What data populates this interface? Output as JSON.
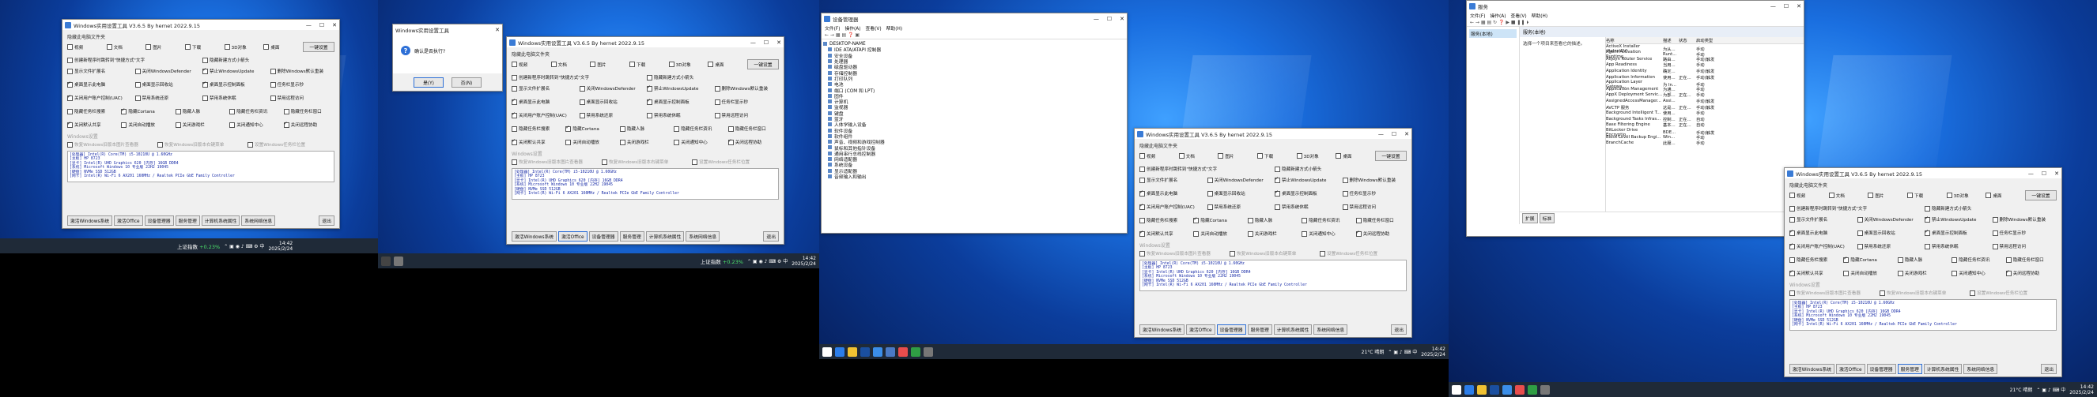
{
  "app": {
    "title": "Windows实用设置工具 V3.6.5 By hernet 2022.9.15",
    "section_hide": "隐藏此电脑文件夹",
    "checks_row1": [
      "视频",
      "文档",
      "图片",
      "下载",
      "3D对象",
      "桌面"
    ],
    "confirm_button": "一键设置",
    "options": [
      [
        "创建新程序时跳转到\"快捷方式\"文字",
        "隐藏新建方式小箭头"
      ],
      [
        "显示文件扩展名",
        "关闭WindowsDefender",
        "禁止WindowsUpdate",
        "删除Windows默认重装"
      ],
      [
        "桌面显示此电脑",
        "桌面显示回收站",
        "桌面显示控制面板",
        "任务栏显示秒"
      ],
      [
        "关闭用户账户控制(UAC)",
        "禁用系统还原",
        "禁用系统休眠",
        "禁用远程访问"
      ],
      [
        "隐藏任务栏搜索",
        "隐藏Cortana",
        "隐藏人脉",
        "隐藏任务栏资讯",
        "隐藏任务栏窗口"
      ],
      [
        "关闭默认共享",
        "关闭自动播放",
        "关闭游戏栏",
        "关闭通知中心",
        "关闭远程协助"
      ]
    ],
    "section_disabled": "Windows设置",
    "disabled_opts": [
      "恢复Windows旧版本图片查看器",
      "恢复Windows旧版本右键菜单",
      "设置Windows任务栏位置"
    ],
    "info_lines": [
      "[处理器] Intel(R) Core(TM) i5-10210U @ 1.60GHz",
      "[主板] HP 8723",
      "[显卡] Intel(R) UHD Graphics 620 [内存] 16GB DDR4",
      "[系统] Microsoft Windows 10 专业版 22H2 19045",
      "[硬盘] NVMe SSD 512GB",
      "[网卡] Intel(R) Wi-Fi 6 AX201 160MHz / Realtek PCIe GbE Family Controller"
    ],
    "tabs": [
      "激活Windows系统",
      "激活Office",
      "设备管理器",
      "服务管理",
      "计算机系统属性",
      "系统网络信息"
    ],
    "exit": "退出"
  },
  "dialog": {
    "title": "Windows实用设置工具",
    "message": "确认是否执行?",
    "yes": "是(Y)",
    "no": "否(N)"
  },
  "devmgr": {
    "title": "设备管理器",
    "menu": [
      "文件(F)",
      "操作(A)",
      "查看(V)",
      "帮助(H)"
    ],
    "items": [
      "DESKTOP-NAME",
      "IDE ATA/ATAPI 控制器",
      "安全设备",
      "处理器",
      "磁盘驱动器",
      "存储控制器",
      "打印队列",
      "电池",
      "端口 (COM 和 LPT)",
      "固件",
      "计算机",
      "监视器",
      "键盘",
      "蓝牙",
      "人体学输入设备",
      "软件设备",
      "软件组件",
      "声音、视频和游戏控制器",
      "鼠标和其他指针设备",
      "通用串行总线控制器",
      "网络适配器",
      "系统设备",
      "显示适配器",
      "音频输入和输出"
    ]
  },
  "services": {
    "title": "服务",
    "menu": [
      "文件(F)",
      "操作(A)",
      "查看(V)",
      "帮助(H)"
    ],
    "left_item": "服务(本地)",
    "head": "服务(本地)",
    "hint": "选择一个项目来查看它的描述。",
    "cols": [
      "名称",
      "描述",
      "状态",
      "启动类型"
    ],
    "rows": [
      [
        "ActiveX Installer (AxInstSV)",
        "为从...",
        "",
        "手动"
      ],
      [
        "Agent Activation Runtime...",
        "Runt...",
        "",
        "手动"
      ],
      [
        "AllJoyn Router Service",
        "路由...",
        "",
        "手动(触发"
      ],
      [
        "App Readiness",
        "当用...",
        "",
        "手动"
      ],
      [
        "Application Identity",
        "确定...",
        "",
        "手动(触发"
      ],
      [
        "Application Information",
        "使用...",
        "正在...",
        "手动(触发"
      ],
      [
        "Application Layer Gatewa...",
        "为 In...",
        "",
        "手动"
      ],
      [
        "Application Management",
        "为通...",
        "",
        "手动"
      ],
      [
        "AppX Deployment Servic...",
        "为部...",
        "正在...",
        "手动"
      ],
      [
        "AssignedAccessManager...",
        "Assi...",
        "",
        "手动(触发"
      ],
      [
        "AVCTP 服务",
        "这是...",
        "正在...",
        "手动(触发"
      ],
      [
        "Background Intelligent T...",
        "使用...",
        "",
        "手动"
      ],
      [
        "Background Tasks Infras...",
        "控制...",
        "正在...",
        "自动"
      ],
      [
        "Base Filtering Engine",
        "基本...",
        "正在...",
        "自动"
      ],
      [
        "BitLocker Drive Encryptio...",
        "BDE...",
        "",
        "手动(触发"
      ],
      [
        "Block Level Backup Engi...",
        "Win...",
        "",
        "手动"
      ],
      [
        "BranchCache",
        "此服...",
        "",
        "手动"
      ]
    ],
    "tabs": [
      "扩展",
      "标准"
    ]
  },
  "taskbar": {
    "stock_name": "上证指数",
    "stock_change": "+0.23%",
    "weather": "21°C 晴朗",
    "time": "14:42",
    "date": "2025/2/24"
  },
  "colors": {
    "accent": "#1a6fe0",
    "taskbar": "#1f2a38",
    "info_text": "#1a2da8"
  }
}
